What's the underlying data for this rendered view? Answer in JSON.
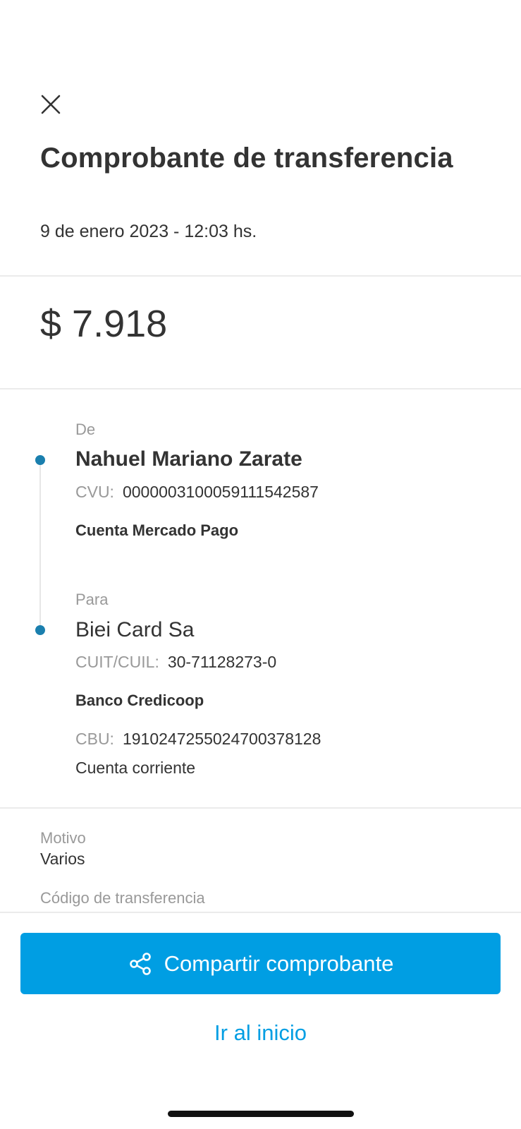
{
  "header": {
    "close_icon": "close-icon",
    "title": "Comprobante de transferencia",
    "date": "9 de enero 2023 - 12:03 hs."
  },
  "amount": "$ 7.918",
  "from": {
    "label": "De",
    "name": "Nahuel Mariano Zarate",
    "id_label": "CVU:",
    "id_value": "0000003100059111542587",
    "account": "Cuenta Mercado Pago"
  },
  "to": {
    "label": "Para",
    "name": "Biei Card Sa",
    "tax_label": "CUIT/CUIL:",
    "tax_value": "30-71128273-0",
    "bank": "Banco Credicoop",
    "cbu_label": "CBU:",
    "cbu_value": "1910247255024700378128",
    "account_type": "Cuenta corriente"
  },
  "details": {
    "reason_label": "Motivo",
    "reason_value": "Varios",
    "code_label": "Código de transferencia"
  },
  "actions": {
    "share_icon": "share-icon",
    "share_label": "Compartir comprobante",
    "home_label": "Ir al inicio"
  },
  "colors": {
    "accent": "#009ee3",
    "timeline_dot": "#1a7fae",
    "text": "#333333",
    "muted": "#999999"
  }
}
